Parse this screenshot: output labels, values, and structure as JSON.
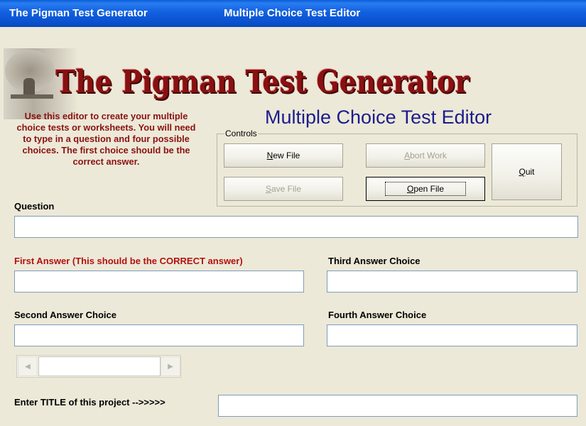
{
  "window": {
    "app_name": "The Pigman Test Generator",
    "title": "Multiple Choice Test Editor"
  },
  "logo_text": "The Pigman Test Generator",
  "subtitle": "Multiple Choice Test Editor",
  "intro_text": "Use this editor to create your multiple choice tests or worksheets.  You will need to type in a question and four possible choices.  The first choice should be the correct answer.",
  "controls": {
    "group_label": "Controls",
    "new_file": {
      "accel": "N",
      "rest": "ew File",
      "enabled": true
    },
    "abort_work": {
      "accel": "A",
      "rest": "bort Work",
      "enabled": false
    },
    "quit": {
      "accel": "Q",
      "rest": "uit",
      "enabled": true
    },
    "save_file": {
      "accel": "S",
      "rest": "ave File",
      "enabled": false
    },
    "open_file": {
      "accel": "O",
      "rest": "pen File",
      "enabled": true,
      "focused": true
    }
  },
  "fields": {
    "question": {
      "label": "Question",
      "value": ""
    },
    "first_answer": {
      "label": "First Answer (This should be the CORRECT answer)",
      "value": "",
      "label_color": "#b31010"
    },
    "second_answer": {
      "label": "Second Answer Choice",
      "value": ""
    },
    "third_answer": {
      "label": "Third Answer Choice",
      "value": ""
    },
    "fourth_answer": {
      "label": "Fourth Answer Choice",
      "value": ""
    },
    "title": {
      "label": "Enter TITLE of this project -->>>>>",
      "value": ""
    }
  },
  "scrollbar": {
    "left_arrow": "◀",
    "right_arrow": "▶"
  },
  "colors": {
    "titlebar": "#0a50cc",
    "window_bg": "#ece9d8",
    "intro_text": "#8b1111",
    "subtitle": "#1c1c8c",
    "logo": "#8a1010"
  }
}
